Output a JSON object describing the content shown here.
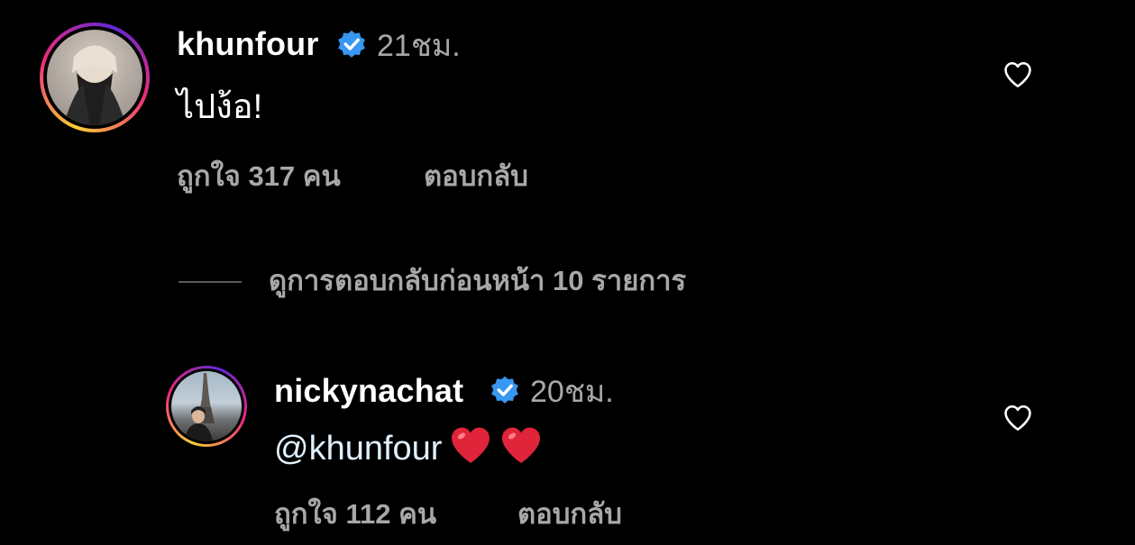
{
  "comments": [
    {
      "username": "khunfour",
      "time": "21ชม.",
      "text": "ไปง้อ!",
      "likes": "ถูกใจ 317 คน",
      "reply": "ตอบกลับ"
    },
    {
      "username": "nickynachat",
      "time": "20ชม.",
      "mention": "@khunfour",
      "emojis": [
        "red-heart-emoji",
        "red-heart-emoji"
      ],
      "likes": "ถูกใจ 112 คน",
      "reply": "ตอบกลับ"
    }
  ],
  "view_previous_replies": "ดูการตอบกลับก่อนหน้า 10 รายการ",
  "colors": {
    "background": "#000000",
    "primary_text": "#ffffff",
    "secondary_text": "#a8a8a8",
    "verified_badge": "#3897f0",
    "mention": "#e0f1ff",
    "heart_emoji": "#e0243a"
  }
}
